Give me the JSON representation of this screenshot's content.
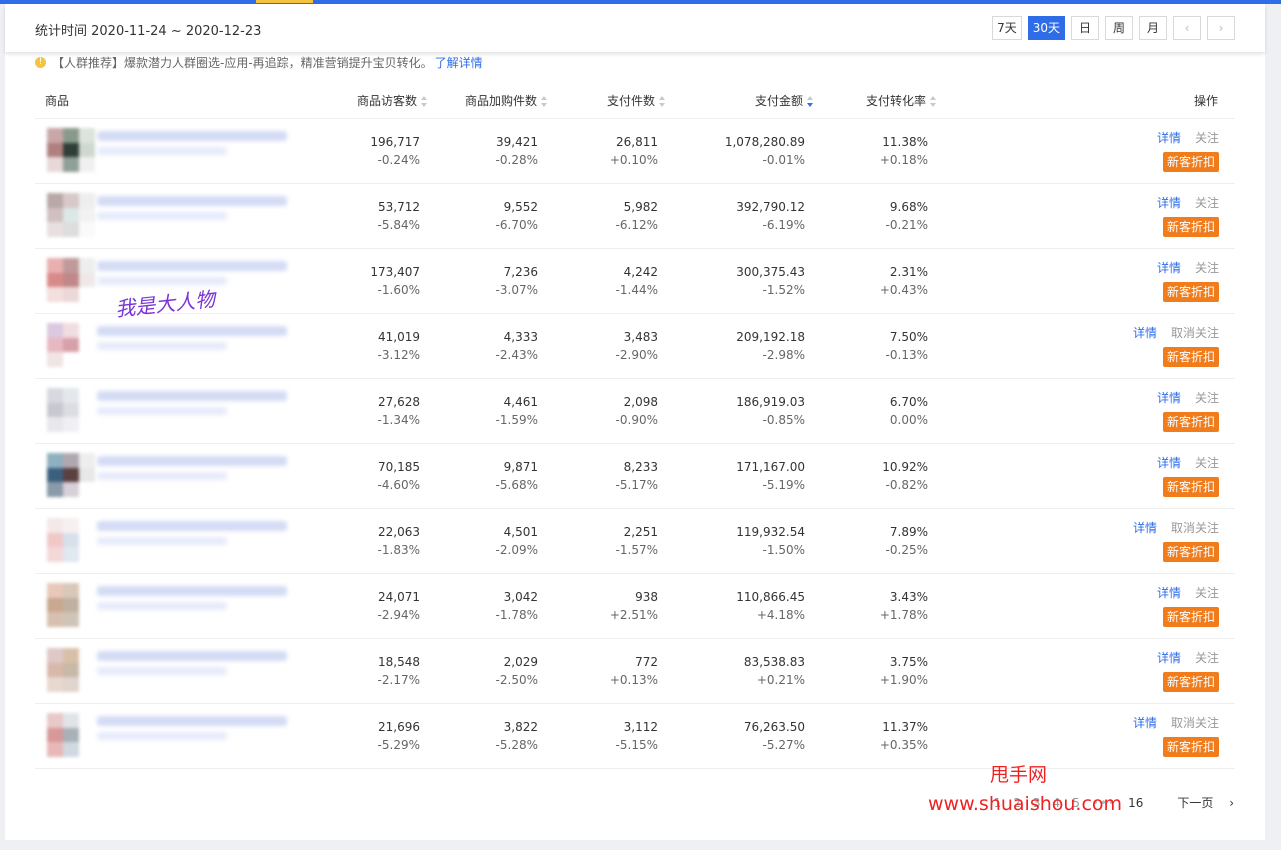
{
  "header": {
    "stat_time": "统计时间 2020-11-24 ~ 2020-12-23",
    "periods": [
      "7天",
      "30天",
      "日",
      "周",
      "月"
    ],
    "active_period": "30天",
    "prev_icon": "chevron-left-icon",
    "next_icon": "chevron-right-icon"
  },
  "notice": {
    "text": "【人群推荐】爆款潜力人群圈选-应用-再追踪，精准营销提升宝贝转化。",
    "link": "了解详情"
  },
  "columns": {
    "product": "商品",
    "visitors": "商品访客数",
    "cart": "商品加购件数",
    "paid_items": "支付件数",
    "paid_amount": "支付金额",
    "conversion": "支付转化率",
    "ops": "操作"
  },
  "rows": [
    {
      "visitors": "196,717",
      "visitors_d": "-0.24%",
      "cart": "39,421",
      "cart_d": "-0.28%",
      "items": "26,811",
      "items_d": "+0.10%",
      "amount": "1,078,280.89",
      "amount_d": "-0.01%",
      "conv": "11.38%",
      "conv_d": "+0.18%",
      "detail": "详情",
      "follow": "关注",
      "discount": "新客折扣"
    },
    {
      "visitors": "53,712",
      "visitors_d": "-5.84%",
      "cart": "9,552",
      "cart_d": "-6.70%",
      "items": "5,982",
      "items_d": "-6.12%",
      "amount": "392,790.12",
      "amount_d": "-6.19%",
      "conv": "9.68%",
      "conv_d": "-0.21%",
      "detail": "详情",
      "follow": "关注",
      "discount": "新客折扣"
    },
    {
      "visitors": "173,407",
      "visitors_d": "-1.60%",
      "cart": "7,236",
      "cart_d": "-3.07%",
      "items": "4,242",
      "items_d": "-1.44%",
      "amount": "300,375.43",
      "amount_d": "-1.52%",
      "conv": "2.31%",
      "conv_d": "+0.43%",
      "detail": "详情",
      "follow": "关注",
      "discount": "新客折扣"
    },
    {
      "visitors": "41,019",
      "visitors_d": "-3.12%",
      "cart": "4,333",
      "cart_d": "-2.43%",
      "items": "3,483",
      "items_d": "-2.90%",
      "amount": "209,192.18",
      "amount_d": "-2.98%",
      "conv": "7.50%",
      "conv_d": "-0.13%",
      "detail": "详情",
      "follow": "取消关注",
      "discount": "新客折扣"
    },
    {
      "visitors": "27,628",
      "visitors_d": "-1.34%",
      "cart": "4,461",
      "cart_d": "-1.59%",
      "items": "2,098",
      "items_d": "-0.90%",
      "amount": "186,919.03",
      "amount_d": "-0.85%",
      "conv": "6.70%",
      "conv_d": "0.00%",
      "detail": "详情",
      "follow": "关注",
      "discount": "新客折扣"
    },
    {
      "visitors": "70,185",
      "visitors_d": "-4.60%",
      "cart": "9,871",
      "cart_d": "-5.68%",
      "items": "8,233",
      "items_d": "-5.17%",
      "amount": "171,167.00",
      "amount_d": "-5.19%",
      "conv": "10.92%",
      "conv_d": "-0.82%",
      "detail": "详情",
      "follow": "关注",
      "discount": "新客折扣"
    },
    {
      "visitors": "22,063",
      "visitors_d": "-1.83%",
      "cart": "4,501",
      "cart_d": "-2.09%",
      "items": "2,251",
      "items_d": "-1.57%",
      "amount": "119,932.54",
      "amount_d": "-1.50%",
      "conv": "7.89%",
      "conv_d": "-0.25%",
      "detail": "详情",
      "follow": "取消关注",
      "discount": "新客折扣"
    },
    {
      "visitors": "24,071",
      "visitors_d": "-2.94%",
      "cart": "3,042",
      "cart_d": "-1.78%",
      "items": "938",
      "items_d": "+2.51%",
      "amount": "110,866.45",
      "amount_d": "+4.18%",
      "conv": "3.43%",
      "conv_d": "+1.78%",
      "detail": "详情",
      "follow": "关注",
      "discount": "新客折扣"
    },
    {
      "visitors": "18,548",
      "visitors_d": "-2.17%",
      "cart": "2,029",
      "cart_d": "-2.50%",
      "items": "772",
      "items_d": "+0.13%",
      "amount": "83,538.83",
      "amount_d": "+0.21%",
      "conv": "3.75%",
      "conv_d": "+1.90%",
      "detail": "详情",
      "follow": "关注",
      "discount": "新客折扣"
    },
    {
      "visitors": "21,696",
      "visitors_d": "-5.29%",
      "cart": "3,822",
      "cart_d": "-5.28%",
      "items": "3,112",
      "items_d": "-5.15%",
      "amount": "76,263.50",
      "amount_d": "-5.27%",
      "conv": "11.37%",
      "conv_d": "+0.35%",
      "detail": "详情",
      "follow": "取消关注",
      "discount": "新客折扣"
    }
  ],
  "thumb_colors": [
    [
      "#c9a7a7",
      "#8a9a8a",
      "#dde3dd",
      "#b08080",
      "#2f3e38",
      "#cfd8d0",
      "#e8d8d8",
      "#90a098",
      "#f0f0f0"
    ],
    [
      "#b8a8a8",
      "#d8c8c8",
      "#eee",
      "#d0c0c0",
      "#dce8e8",
      "#f2f2f2",
      "#e8e0e0",
      "#ddd",
      "#fafafa"
    ],
    [
      "#e8b0b0",
      "#c09a9a",
      "#eee",
      "#d88a8a",
      "#c08888",
      "#f0e8e8",
      "#f4dede",
      "#ecd8d8",
      "#fff"
    ],
    [
      "#dcc8e0",
      "#f0dde0",
      "#fff",
      "#e8b8c0",
      "#d8a0a8",
      "#fff",
      "#f0e4e4",
      "#fff",
      "#fff"
    ],
    [
      "#d8d8e0",
      "#e4e8ec",
      "#fff",
      "#c8c8d0",
      "#dcdce4",
      "#fff",
      "#e8e8ec",
      "#f0f0f4",
      "#fff"
    ],
    [
      "#8fb0c0",
      "#b0a8b0",
      "#eee",
      "#3a6080",
      "#5a4040",
      "#e8e8e8",
      "#8a9aa8",
      "#d8d0d8",
      "#fff"
    ],
    [
      "#f4e8e8",
      "#f8f0f0",
      "#fff",
      "#f0c8c8",
      "#d8e0ec",
      "#fff",
      "#f4d8d8",
      "#e0e8f0",
      "#fff"
    ],
    [
      "#e8c8b8",
      "#d8c8b8",
      "#fff",
      "#c8a890",
      "#c0b0a0",
      "#fff",
      "#d8c0b0",
      "#d0c4b8",
      "#fff"
    ],
    [
      "#e0c8c8",
      "#d8c0a8",
      "#fff",
      "#d8b8a8",
      "#c8b8a8",
      "#fff",
      "#e8d8d0",
      "#e0d4cc",
      "#fff"
    ],
    [
      "#e8c8c8",
      "#e0e4e8",
      "#fff",
      "#d89898",
      "#a8b0b8",
      "#fff",
      "#e8b8b8",
      "#d0d8e0",
      "#fff"
    ]
  ],
  "handwriting": "我是大人物",
  "pager": {
    "pages": [
      "1",
      "2",
      "3",
      "4",
      "5"
    ],
    "ellipsis": "•••",
    "last": "16",
    "next": "下一页"
  },
  "watermark": {
    "line1": "甩手网",
    "line2": "www.shuaishou.com"
  }
}
